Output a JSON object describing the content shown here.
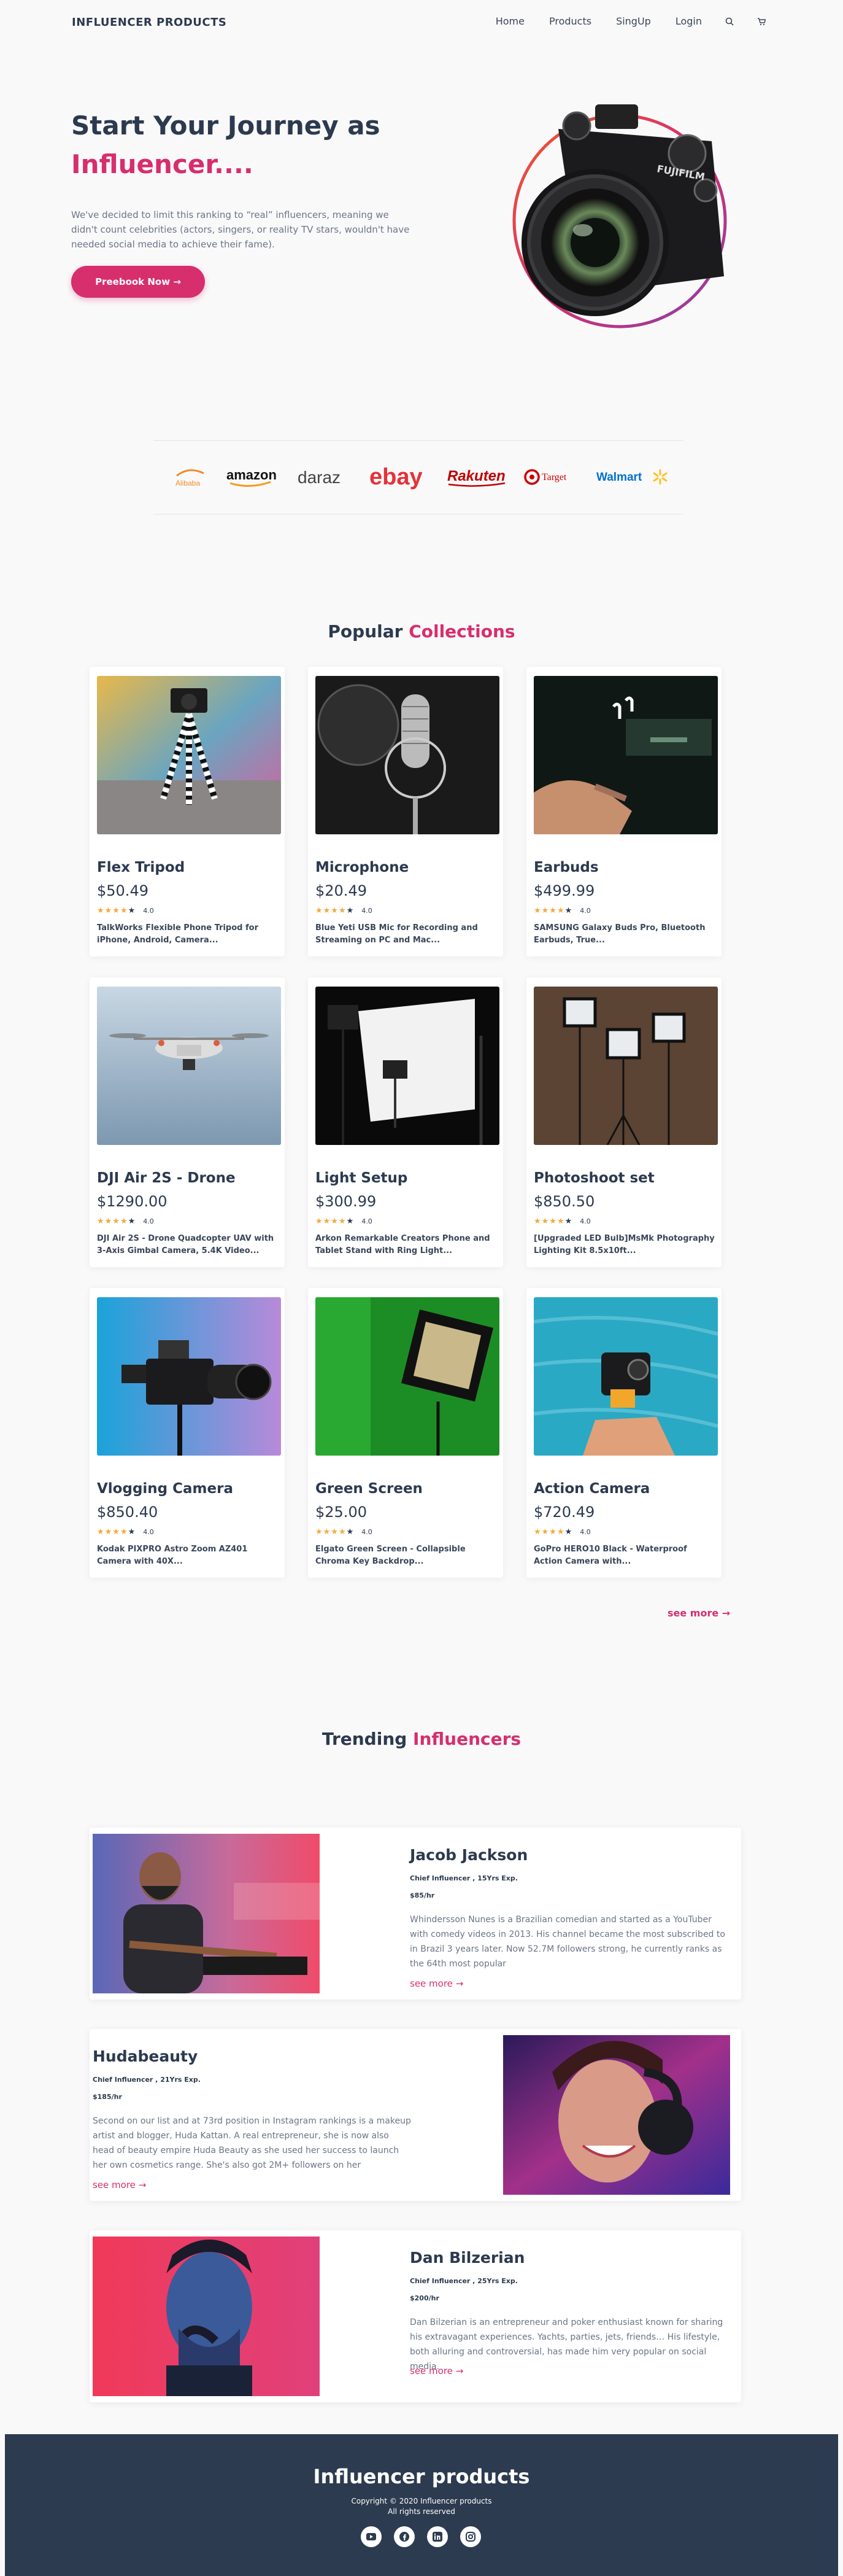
{
  "nav": {
    "brand": "INFLUENCER PRODUCTS",
    "links": [
      "Home",
      "Products",
      "SingUp",
      "Login"
    ]
  },
  "hero": {
    "title_line1": "Start Your Journey as",
    "title_line2": "Influencer....",
    "text": "We've decided to limit this ranking to “real” influencers, meaning we didn't count celebrities (actors, singers, or reality TV stars, wouldn't have needed social media to achieve their fame).",
    "button": "Preebook Now →",
    "camera_brand": "FUJIFILM"
  },
  "brands": [
    "Alibaba",
    "amazon",
    "daraz",
    "ebay",
    "Rakuten",
    "Target",
    "Walmart"
  ],
  "collections": {
    "title_a": "Popular ",
    "title_b": "Collections",
    "items": [
      {
        "name": "Flex Tripod",
        "price": "$50.49",
        "rating": "4.0",
        "desc": "TalkWorks Flexible Phone Tripod for iPhone, Android, Camera..."
      },
      {
        "name": "Microphone",
        "price": "$20.49",
        "rating": "4.0",
        "desc": "Blue Yeti USB Mic for Recording and Streaming on PC and Mac..."
      },
      {
        "name": "Earbuds",
        "price": "$499.99",
        "rating": "4.0",
        "desc": "SAMSUNG Galaxy Buds Pro, Bluetooth Earbuds, True..."
      },
      {
        "name": "DJI Air 2S - Drone",
        "price": "$1290.00",
        "rating": "4.0",
        "desc": "DJI Air 2S - Drone Quadcopter UAV with 3-Axis Gimbal Camera, 5.4K Video..."
      },
      {
        "name": "Light Setup",
        "price": "$300.99",
        "rating": "4.0",
        "desc": "Arkon Remarkable Creators Phone and Tablet Stand with Ring Light..."
      },
      {
        "name": "Photoshoot set",
        "price": "$850.50",
        "rating": "4.0",
        "desc": "[Upgraded LED Bulb]MsMk Photography Lighting Kit 8.5x10ft..."
      },
      {
        "name": "Vlogging Camera",
        "price": "$850.40",
        "rating": "4.0",
        "desc": "Kodak PIXPRO Astro Zoom AZ401 Camera with 40X..."
      },
      {
        "name": "Green Screen",
        "price": "$25.00",
        "rating": "4.0",
        "desc": "Elgato Green Screen - Collapsible Chroma Key Backdrop..."
      },
      {
        "name": "Action Camera",
        "price": "$720.49",
        "rating": "4.0",
        "desc": "GoPro HERO10 Black - Waterproof Action Camera with..."
      }
    ],
    "see_more": "see more"
  },
  "influencers": {
    "title_a": "Trending ",
    "title_b": "Influencers",
    "items": [
      {
        "name": "Jacob Jackson",
        "role": "Chief Influencer , 15Yrs Exp.",
        "rate": "$85/hr",
        "bio": "Whindersson Nunes is a Brazilian comedian and started as a YouTuber with comedy videos in 2013. His channel became the most subscribed to in Brazil 3 years later. Now 52.7M followers strong, he currently ranks as the 64th most popular",
        "more": "see more"
      },
      {
        "name": "Hudabeauty",
        "role": "Chief Influencer , 21Yrs Exp.",
        "rate": "$185/hr",
        "bio": "Second on our list and at 73rd position in Instagram rankings is a makeup artist and blogger, Huda Kattan. A real entrepreneur, she is now also head of beauty empire Huda Beauty as she used her success to launch her own cosmetics range. She's also got 2M+ followers on her",
        "more": "see more"
      },
      {
        "name": "Dan Bilzerian",
        "role": "Chief Influencer , 25Yrs Exp.",
        "rate": "$200/hr",
        "bio": "Dan Bilzerian is an entrepreneur and poker enthusiast known for sharing his extravagant experiences. Yachts, parties, jets, friends… His lifestyle, both alluring and controversial, has made him very popular on social media.",
        "more": "see more"
      }
    ]
  },
  "footer": {
    "title": "Influencer products",
    "copy1": "Copyright © 2020 Influencer products",
    "copy2": "All rights reserved",
    "socials": [
      "youtube-icon",
      "facebook-icon",
      "linkedin-icon",
      "instagram-icon"
    ]
  },
  "colors": {
    "accent": "#d72e6d",
    "text": "#2c3a4f",
    "footer": "#2d3b50"
  }
}
